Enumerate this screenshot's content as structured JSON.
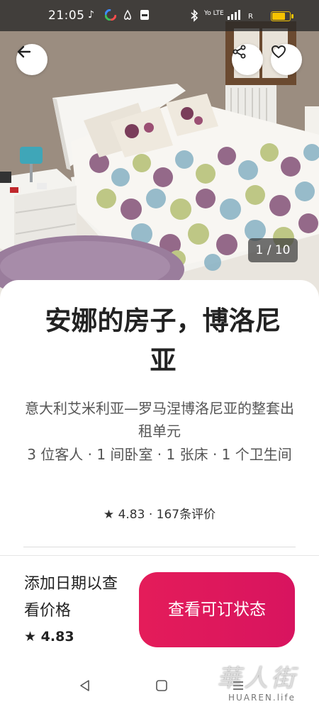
{
  "status_bar": {
    "time": "21:05",
    "icons": [
      "tiktok-icon",
      "colorful-app-icon",
      "airbnb-icon",
      "pdf-icon",
      "bluetooth-icon",
      "volte-icon",
      "signal-icon",
      "battery-icon"
    ],
    "volte_text": "Yo LTE",
    "signal_text": "R"
  },
  "photo": {
    "counter": "1 / 10",
    "description_icons": [
      "back-arrow-icon",
      "share-icon",
      "heart-icon"
    ]
  },
  "listing": {
    "title": "安娜的房子，博洛尼亚",
    "subtitle": "意大利艾米利亚—罗马涅博洛尼亚的整套出租单元",
    "details": "3 位客人 · 1 间卧室 · 1 张床 · 1 个卫生间",
    "rating": "4.83",
    "separator": "·",
    "reviews": "167条评价"
  },
  "footer": {
    "price_prompt": "添加日期以查看价格",
    "rating": "4.83",
    "cta_label": "查看可订状态"
  },
  "watermark": {
    "cn": "華人街",
    "en": "HUAREN.life"
  },
  "colors": {
    "accent": "#e41c5a",
    "status_bar_bg": "#2a2a2a"
  }
}
